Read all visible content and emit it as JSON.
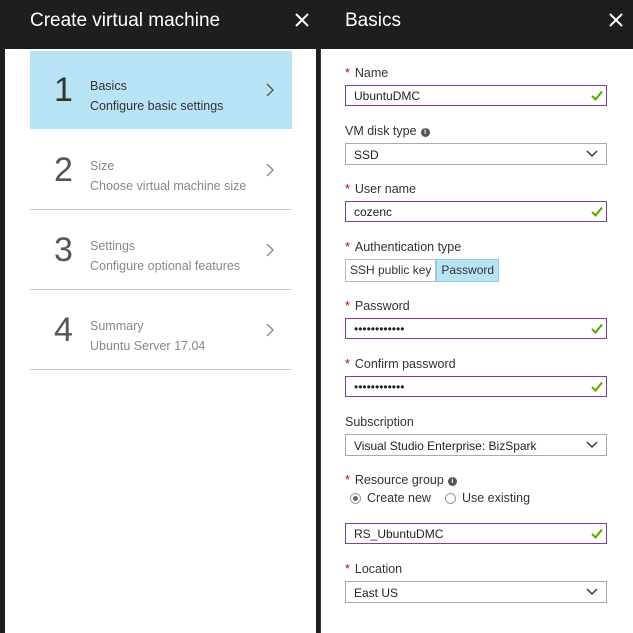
{
  "left_panel": {
    "title": "Create virtual machine",
    "steps": [
      {
        "number": "1",
        "title": "Basics",
        "subtitle": "Configure basic settings",
        "active": true
      },
      {
        "number": "2",
        "title": "Size",
        "subtitle": "Choose virtual machine size",
        "active": false
      },
      {
        "number": "3",
        "title": "Settings",
        "subtitle": "Configure optional features",
        "active": false
      },
      {
        "number": "4",
        "title": "Summary",
        "subtitle": "Ubuntu Server 17.04",
        "active": false
      }
    ]
  },
  "right_panel": {
    "title": "Basics",
    "name": {
      "label": "Name",
      "value": "UbuntuDMC"
    },
    "vm_disk_type": {
      "label": "VM disk type",
      "value": "SSD"
    },
    "user_name": {
      "label": "User name",
      "value": "cozenc"
    },
    "auth_type": {
      "label": "Authentication type",
      "options": [
        "SSH public key",
        "Password"
      ],
      "selected": "Password"
    },
    "password": {
      "label": "Password",
      "value": "••••••••••••"
    },
    "confirm_password": {
      "label": "Confirm password",
      "value": "••••••••••••"
    },
    "subscription": {
      "label": "Subscription",
      "value": "Visual Studio Enterprise: BizSpark"
    },
    "resource_group": {
      "label": "Resource group",
      "options": [
        "Create new",
        "Use existing"
      ],
      "selected": "Create new",
      "value": "RS_UbuntuDMC"
    },
    "location": {
      "label": "Location",
      "value": "East US"
    }
  },
  "colors": {
    "accent": "#b7e3f5",
    "valid_border": "#7a3fa0",
    "valid_check": "#5ea500",
    "required": "#cc0000",
    "header_bg": "#1e1e1e"
  },
  "icons": {
    "close": "close-icon",
    "chevron": "chevron-right-icon",
    "dropdown": "chevron-down-icon",
    "check": "check-icon",
    "info": "info-icon"
  }
}
